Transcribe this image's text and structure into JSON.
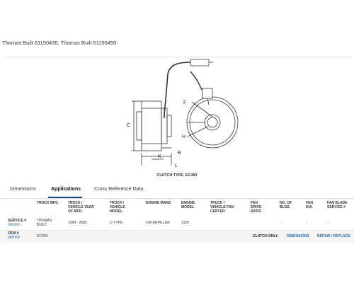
{
  "page": {
    "title": "Thomas Built 61190430, Thomas Built 61190450"
  },
  "diagram": {
    "labels": {
      "c": "C",
      "f": "F",
      "h": "H",
      "k": "K",
      "b": "B",
      "l": "L"
    },
    "caption": "CLUTCH TYPE: EC450"
  },
  "tabs": [
    {
      "label": "Dimensions",
      "active": false
    },
    {
      "label": "Applications",
      "active": true
    },
    {
      "label": "Cross Reference Data",
      "active": false
    }
  ],
  "table": {
    "headers": [
      "TRUCK MFG",
      "TRUCK / VEHICLE YEAR OF MFR",
      "TRUCK / VEHICLE MODEL",
      "ENGINE MAKE",
      "ENGINE MODEL",
      "TRUCK / VEHICLE FAN CENTER",
      "FAN DRIVE RATIO",
      "NO. OF BLDS.",
      "FAN DIA.",
      "FAN BLADE SERVICE #"
    ],
    "row": {
      "service_label": "SERVICE #",
      "service_value": "996043",
      "truck_mfg": "THOMAS BUILT",
      "year": "1999 - 2005",
      "model": "C-TYPE",
      "engine_make": "CATERPILLAR",
      "engine_model": "3126",
      "blds": "-",
      "dia": "-",
      "blade_service": "-"
    },
    "oem": {
      "label": "OEM #",
      "value": "985059",
      "clutch": "EC450",
      "clutch_only": "CLUTCH ONLY.",
      "dimensions_link": "DIMENSIONS",
      "repair_link": "REPAIR / REPLACE"
    }
  },
  "colors": {
    "link": "#2a6db0",
    "tab_underline": "#1a4e8a"
  }
}
